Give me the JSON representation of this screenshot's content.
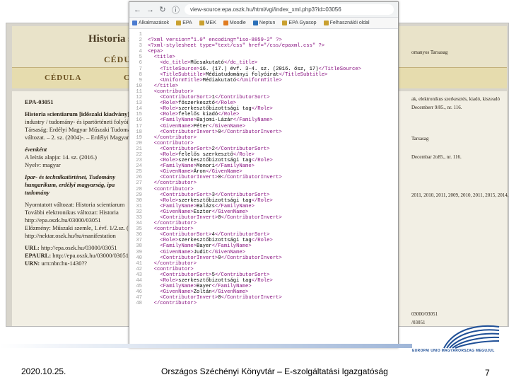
{
  "catalog": {
    "title": "Historia sc",
    "subtitle": "CÉDULA F",
    "tab_cedula": "CÉDULA",
    "tab_cim": "CIM",
    "record_id": "EPA-03051",
    "record_lines": [
      "Historia scientiarum [időszaki kiadvány]",
      "industry / tudomány- és ipartörténeti folyóirat",
      "Társaság; Erdélyi Magyar Műszaki Tudomány",
      "változat. – 2. sz. (2004)-. – Erdélyi Magyar"
    ],
    "frequency_label": "évenként",
    "description_basis": "A leírás alapja: 14. sz. (2016.)",
    "language": "Nyelv: magyar",
    "subject_lines": [
      "Ipar- és technikatörténet, Tudomány",
      "hungarikum, erdélyi magyarság, ipa",
      "tudomány"
    ],
    "print_version": "Nyomtatott változat: Historia scientiarum",
    "other_electronic": "További elektronikus változat: Historia",
    "other_url": "http://epa.oszk.hu/03000/03051",
    "predecessor": "Előzmény: Műszaki szemle, 1.évf. 1/2.sz. (1",
    "predecessor_url": "http://nektar.oszk.hu/hu/manifestation",
    "url_label": "URL:",
    "url_value": "http://epa.oszk.hu/03000/03051",
    "epaurl_label": "EPAURL:",
    "epaurl_value": "http://epa.oszk.hu/03000/03051",
    "urn_label": "URN:",
    "urn_value": "urn:nbn:hu-1430??",
    "right_snippets": [
      "omanyos Tarsasag",
      "ak, elektronikus szerkesztés, kiadó, kiszeadó",
      "Decemberr 9/85., nr. 116.",
      "Tarsasag",
      "Decembar 2o85., nr. 116.",
      "2011, 2010, 2011, 2009, 2010, 2011, 2015, 2014,",
      "03000/03051",
      "/03051"
    ]
  },
  "browser": {
    "url": "view-source:epa.oszk.hu/html/vgi/index_xml.php3?id=03056",
    "bookmarks": [
      "Alkalmazások",
      "EPA",
      "MEK",
      "Moodle",
      "Neptun",
      "EPA Gyasop",
      "Felhasználói oldal"
    ],
    "code_lines": [
      {
        "n": "1",
        "parts": [
          [
            "t",
            ""
          ]
        ]
      },
      {
        "n": "2",
        "parts": [
          [
            "m",
            "<?xml version=\"1.0\" encoding=\"iso-8859-2\" ?>"
          ]
        ]
      },
      {
        "n": "3",
        "parts": [
          [
            "m",
            "<?xml-stylesheet type=\"text/css\" href=\"/css/epaxml.css\" ?>"
          ]
        ]
      },
      {
        "n": "4",
        "parts": [
          [
            "m",
            "<epa>"
          ]
        ]
      },
      {
        "n": "5",
        "parts": [
          [
            "m",
            "  <title>"
          ]
        ]
      },
      {
        "n": "6",
        "parts": [
          [
            "m",
            "    <dc_title>"
          ],
          [
            "t",
            "Műcsakutató"
          ],
          [
            "m",
            "</dc_title>"
          ]
        ]
      },
      {
        "n": "7",
        "parts": [
          [
            "m",
            "    <TitleSource>"
          ],
          [
            "t",
            "16. (17.) évf. 3-4. sz. (2016. ősz, 17)"
          ],
          [
            "m",
            "</TitleSource>"
          ]
        ]
      },
      {
        "n": "8",
        "parts": [
          [
            "m",
            "    <TitleSubtitle>"
          ],
          [
            "t",
            "Médiatudományi folyóirat"
          ],
          [
            "m",
            "</TitleSubtitle>"
          ]
        ]
      },
      {
        "n": "9",
        "parts": [
          [
            "m",
            "    <UniformTitle>"
          ],
          [
            "t",
            "Médiakutató"
          ],
          [
            "m",
            "</UniformTitle>"
          ]
        ]
      },
      {
        "n": "10",
        "parts": [
          [
            "m",
            "  </title>"
          ]
        ]
      },
      {
        "n": "11",
        "parts": [
          [
            "m",
            "  <contributor>"
          ]
        ]
      },
      {
        "n": "12",
        "parts": [
          [
            "m",
            "    <ContributorSort>"
          ],
          [
            "t",
            "1"
          ],
          [
            "m",
            "</ContributorSort>"
          ]
        ]
      },
      {
        "n": "13",
        "parts": [
          [
            "m",
            "    <Role>"
          ],
          [
            "t",
            "főszerkesztő"
          ],
          [
            "m",
            "</Role>"
          ]
        ]
      },
      {
        "n": "14",
        "parts": [
          [
            "m",
            "    <Role>"
          ],
          [
            "t",
            "szerkesztőbizottsági tag"
          ],
          [
            "m",
            "</Role>"
          ]
        ]
      },
      {
        "n": "15",
        "parts": [
          [
            "m",
            "    <Role>"
          ],
          [
            "t",
            "felelős kiadó"
          ],
          [
            "m",
            "</Role>"
          ]
        ]
      },
      {
        "n": "16",
        "parts": [
          [
            "m",
            "    <FamilyName>"
          ],
          [
            "t",
            "Bajomi-Lázár"
          ],
          [
            "m",
            "</FamilyName>"
          ]
        ]
      },
      {
        "n": "17",
        "parts": [
          [
            "m",
            "    <GivenName>"
          ],
          [
            "t",
            "Péter"
          ],
          [
            "m",
            "</GivenName>"
          ]
        ]
      },
      {
        "n": "18",
        "parts": [
          [
            "m",
            "    <ContributorInvert>"
          ],
          [
            "t",
            "0"
          ],
          [
            "m",
            "</ContributorInvert>"
          ]
        ]
      },
      {
        "n": "19",
        "parts": [
          [
            "m",
            "  </contributor>"
          ]
        ]
      },
      {
        "n": "20",
        "parts": [
          [
            "m",
            "  <contributor>"
          ]
        ]
      },
      {
        "n": "21",
        "parts": [
          [
            "m",
            "    <ContributorSort>"
          ],
          [
            "t",
            "2"
          ],
          [
            "m",
            "</ContributorSort>"
          ]
        ]
      },
      {
        "n": "22",
        "parts": [
          [
            "m",
            "    <Role>"
          ],
          [
            "t",
            "felelős szerkesztő"
          ],
          [
            "m",
            "</Role>"
          ]
        ]
      },
      {
        "n": "23",
        "parts": [
          [
            "m",
            "    <Role>"
          ],
          [
            "t",
            "szerkesztőbizottsági tag"
          ],
          [
            "m",
            "</Role>"
          ]
        ]
      },
      {
        "n": "24",
        "parts": [
          [
            "m",
            "    <FamilyName>"
          ],
          [
            "t",
            "Monori"
          ],
          [
            "m",
            "</FamilyName>"
          ]
        ]
      },
      {
        "n": "25",
        "parts": [
          [
            "m",
            "    <GivenName>"
          ],
          [
            "t",
            "Áron"
          ],
          [
            "m",
            "</GivenName>"
          ]
        ]
      },
      {
        "n": "26",
        "parts": [
          [
            "m",
            "    <ContributorInvert>"
          ],
          [
            "t",
            "0"
          ],
          [
            "m",
            "</ContributorInvert>"
          ]
        ]
      },
      {
        "n": "27",
        "parts": [
          [
            "m",
            "  </contributor>"
          ]
        ]
      },
      {
        "n": "28",
        "parts": [
          [
            "m",
            "  <contributor>"
          ]
        ]
      },
      {
        "n": "29",
        "parts": [
          [
            "m",
            "    <ContributorSort>"
          ],
          [
            "t",
            "3"
          ],
          [
            "m",
            "</ContributorSort>"
          ]
        ]
      },
      {
        "n": "30",
        "parts": [
          [
            "m",
            "    <Role>"
          ],
          [
            "t",
            "szerkesztőbizottsági tag"
          ],
          [
            "m",
            "</Role>"
          ]
        ]
      },
      {
        "n": "31",
        "parts": [
          [
            "m",
            "    <FamilyName>"
          ],
          [
            "t",
            "Balázs"
          ],
          [
            "m",
            "</FamilyName>"
          ]
        ]
      },
      {
        "n": "32",
        "parts": [
          [
            "m",
            "    <GivenName>"
          ],
          [
            "t",
            "Eszter"
          ],
          [
            "m",
            "</GivenName>"
          ]
        ]
      },
      {
        "n": "33",
        "parts": [
          [
            "m",
            "    <ContributorInvert>"
          ],
          [
            "t",
            "0"
          ],
          [
            "m",
            "</ContributorInvert>"
          ]
        ]
      },
      {
        "n": "34",
        "parts": [
          [
            "m",
            "  </contributor>"
          ]
        ]
      },
      {
        "n": "35",
        "parts": [
          [
            "m",
            "  <contributor>"
          ]
        ]
      },
      {
        "n": "36",
        "parts": [
          [
            "m",
            "    <ContributorSort>"
          ],
          [
            "t",
            "4"
          ],
          [
            "m",
            "</ContributorSort>"
          ]
        ]
      },
      {
        "n": "37",
        "parts": [
          [
            "m",
            "    <Role>"
          ],
          [
            "t",
            "szerkesztőbizottsági tag"
          ],
          [
            "m",
            "</Role>"
          ]
        ]
      },
      {
        "n": "38",
        "parts": [
          [
            "m",
            "    <FamilyName>"
          ],
          [
            "t",
            "Bayer"
          ],
          [
            "m",
            "</FamilyName>"
          ]
        ]
      },
      {
        "n": "39",
        "parts": [
          [
            "m",
            "    <GivenName>"
          ],
          [
            "t",
            "Judit"
          ],
          [
            "m",
            "</GivenName>"
          ]
        ]
      },
      {
        "n": "40",
        "parts": [
          [
            "m",
            "    <ContributorInvert>"
          ],
          [
            "t",
            "0"
          ],
          [
            "m",
            "</ContributorInvert>"
          ]
        ]
      },
      {
        "n": "41",
        "parts": [
          [
            "m",
            "  </contributor>"
          ]
        ]
      },
      {
        "n": "42",
        "parts": [
          [
            "m",
            "  <contributor>"
          ]
        ]
      },
      {
        "n": "43",
        "parts": [
          [
            "m",
            "    <ContributorSort>"
          ],
          [
            "t",
            "5"
          ],
          [
            "m",
            "</ContributorSort>"
          ]
        ]
      },
      {
        "n": "44",
        "parts": [
          [
            "m",
            "    <Role>"
          ],
          [
            "t",
            "szerkesztőbizottsági tag"
          ],
          [
            "m",
            "</Role>"
          ]
        ]
      },
      {
        "n": "45",
        "parts": [
          [
            "m",
            "    <FamilyName>"
          ],
          [
            "t",
            "Bayer"
          ],
          [
            "m",
            "</FamilyName>"
          ]
        ]
      },
      {
        "n": "46",
        "parts": [
          [
            "m",
            "    <GivenName>"
          ],
          [
            "t",
            "Zoltán"
          ],
          [
            "m",
            "</GivenName>"
          ]
        ]
      },
      {
        "n": "47",
        "parts": [
          [
            "m",
            "    <ContributorInvert>"
          ],
          [
            "t",
            "0"
          ],
          [
            "m",
            "</ContributorInvert>"
          ]
        ]
      },
      {
        "n": "48",
        "parts": [
          [
            "m",
            "  </contributor>"
          ]
        ]
      }
    ]
  },
  "footer": {
    "date": "2020.10.25.",
    "center": "Országos Széchényi Könyvtár – E-szolgáltatási Igazgatóság",
    "page": "7",
    "logo_caption": "EUROPAI UNIO  MAGYARORSZAG MEGUJUL",
    "accent": "#1f4f96"
  }
}
